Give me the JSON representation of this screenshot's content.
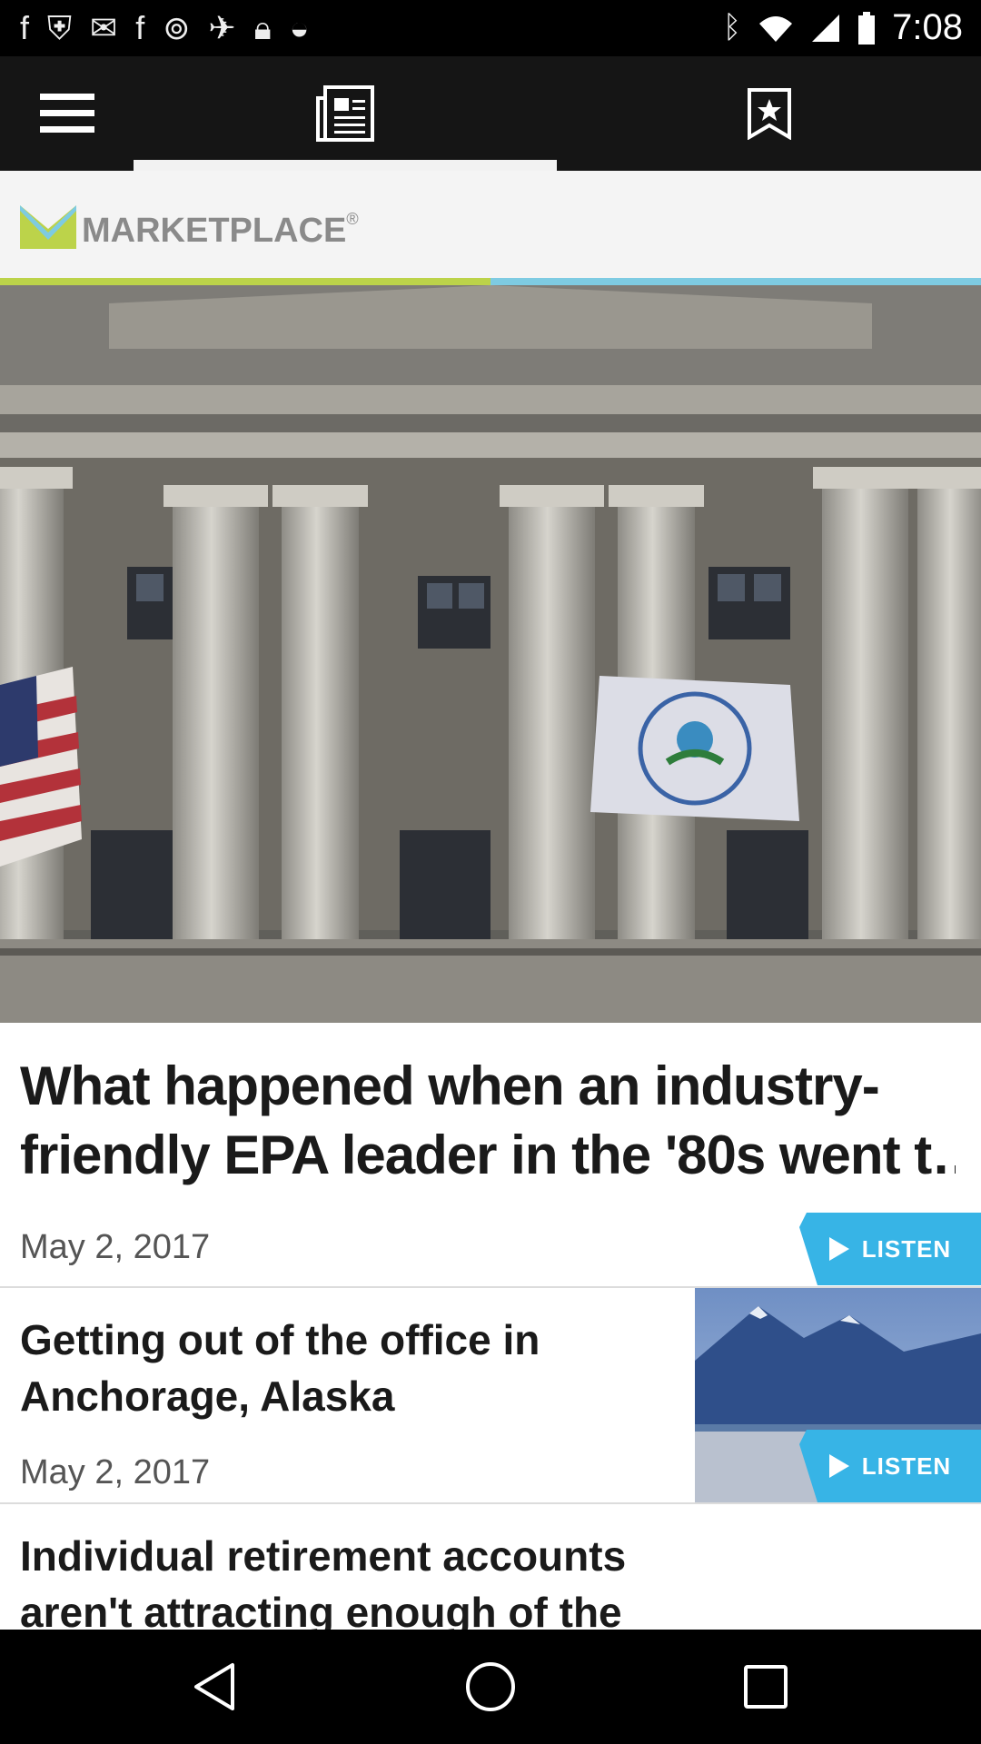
{
  "status_bar": {
    "time": "7:08",
    "left_icons": [
      "facebook-icon",
      "shield-icon",
      "mail-icon",
      "facebook-icon",
      "at-icon",
      "satellite-icon",
      "lock-icon",
      "android-icon"
    ],
    "right_icons": [
      "bluetooth-icon",
      "wifi-icon",
      "signal-icon",
      "battery-icon"
    ]
  },
  "toolbar": {
    "menu_icon": "menu-icon",
    "news_icon": "newspaper-icon",
    "bookmark_icon": "bookmark-star-icon",
    "active_tab": "news"
  },
  "brand": {
    "logo_text": "MARKETPLACE",
    "mark": "®",
    "colors": {
      "green": "#bcd34a",
      "blue": "#7ecbe2",
      "grey": "#8a8a8a"
    }
  },
  "articles": [
    {
      "title": "What happened when an industry-friendly EPA leader in the '80s went t…",
      "title_lines": [
        "What happened when an industry-",
        "friendly EPA leader in the '80s went t…"
      ],
      "date": "May 2, 2017",
      "listen_label": "LISTEN",
      "image": "epa-building-photo"
    },
    {
      "title_lines": [
        "Getting out of the office in",
        "Anchorage, Alaska"
      ],
      "date": "May 2, 2017",
      "listen_label": "LISTEN",
      "image": "alaska-mountains-photo"
    },
    {
      "title_lines": [
        "Individual retirement accounts",
        "aren't attracting enough of the r…"
      ]
    }
  ],
  "nav": {
    "back_icon": "back-icon",
    "home_icon": "home-icon",
    "recents_icon": "recents-icon"
  },
  "accent_color": "#37b4e6"
}
